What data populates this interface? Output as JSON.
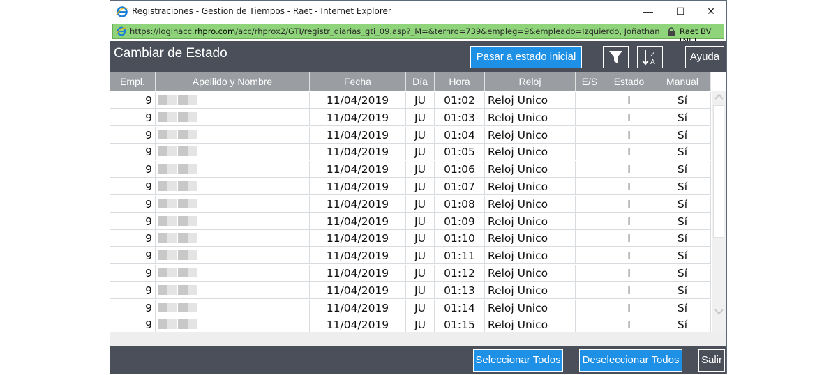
{
  "window": {
    "title": "Registraciones - Gestion de Tiempos - Raet - Internet Explorer",
    "minimize": "—",
    "maximize": "☐",
    "close": "✕"
  },
  "address": {
    "url_prefix": "https://loginacc.",
    "url_domain": "rhpro.com",
    "url_rest": "/acc/rhprox2/GTI/registr_diarias_gti_09.asp?_M=&ternro=739&empleg=9&empleado=Izquierdo, Joñathan&fechadesde",
    "certificate": "Raet BV [NL]"
  },
  "header": {
    "title": "Cambiar de Estado",
    "reset_label": "Pasar a estado inicial",
    "help_label": "Ayuda"
  },
  "table": {
    "columns": [
      "Empl.",
      "Apellido y Nombre",
      "Fecha",
      "Día",
      "Hora",
      "Reloj",
      "E/S",
      "Estado",
      "Manual"
    ],
    "rows": [
      {
        "empl": "9",
        "fecha": "11/04/2019",
        "dia": "JU",
        "hora": "01:02",
        "reloj": "Reloj Unico",
        "es": "",
        "estado": "I",
        "manual": "Sí"
      },
      {
        "empl": "9",
        "fecha": "11/04/2019",
        "dia": "JU",
        "hora": "01:03",
        "reloj": "Reloj Unico",
        "es": "",
        "estado": "I",
        "manual": "Sí"
      },
      {
        "empl": "9",
        "fecha": "11/04/2019",
        "dia": "JU",
        "hora": "01:04",
        "reloj": "Reloj Unico",
        "es": "",
        "estado": "I",
        "manual": "Sí"
      },
      {
        "empl": "9",
        "fecha": "11/04/2019",
        "dia": "JU",
        "hora": "01:05",
        "reloj": "Reloj Unico",
        "es": "",
        "estado": "I",
        "manual": "Sí"
      },
      {
        "empl": "9",
        "fecha": "11/04/2019",
        "dia": "JU",
        "hora": "01:06",
        "reloj": "Reloj Unico",
        "es": "",
        "estado": "I",
        "manual": "Sí"
      },
      {
        "empl": "9",
        "fecha": "11/04/2019",
        "dia": "JU",
        "hora": "01:07",
        "reloj": "Reloj Unico",
        "es": "",
        "estado": "I",
        "manual": "Sí"
      },
      {
        "empl": "9",
        "fecha": "11/04/2019",
        "dia": "JU",
        "hora": "01:08",
        "reloj": "Reloj Unico",
        "es": "",
        "estado": "I",
        "manual": "Sí"
      },
      {
        "empl": "9",
        "fecha": "11/04/2019",
        "dia": "JU",
        "hora": "01:09",
        "reloj": "Reloj Unico",
        "es": "",
        "estado": "I",
        "manual": "Sí"
      },
      {
        "empl": "9",
        "fecha": "11/04/2019",
        "dia": "JU",
        "hora": "01:10",
        "reloj": "Reloj Unico",
        "es": "",
        "estado": "I",
        "manual": "Sí"
      },
      {
        "empl": "9",
        "fecha": "11/04/2019",
        "dia": "JU",
        "hora": "01:11",
        "reloj": "Reloj Unico",
        "es": "",
        "estado": "I",
        "manual": "Sí"
      },
      {
        "empl": "9",
        "fecha": "11/04/2019",
        "dia": "JU",
        "hora": "01:12",
        "reloj": "Reloj Unico",
        "es": "",
        "estado": "I",
        "manual": "Sí"
      },
      {
        "empl": "9",
        "fecha": "11/04/2019",
        "dia": "JU",
        "hora": "01:13",
        "reloj": "Reloj Unico",
        "es": "",
        "estado": "I",
        "manual": "Sí"
      },
      {
        "empl": "9",
        "fecha": "11/04/2019",
        "dia": "JU",
        "hora": "01:14",
        "reloj": "Reloj Unico",
        "es": "",
        "estado": "I",
        "manual": "Sí"
      },
      {
        "empl": "9",
        "fecha": "11/04/2019",
        "dia": "JU",
        "hora": "01:15",
        "reloj": "Reloj Unico",
        "es": "",
        "estado": "I",
        "manual": "Sí"
      }
    ]
  },
  "footer": {
    "select_all_label": "Seleccionar Todos",
    "deselect_all_label": "Deseleccionar Todos",
    "exit_label": "Salir"
  },
  "icons": {
    "browser": "internet-explorer-icon",
    "lock": "lock-icon",
    "filter": "filter-icon",
    "sort": "sort-z-a-icon",
    "scroll_up": "chevron-up-icon",
    "scroll_down": "chevron-down-icon"
  },
  "colors": {
    "header_bg": "#4a4f5a",
    "accent_blue": "#1e90e6",
    "table_header_bg": "#9a9da2",
    "address_bar_green": "#8fd47a"
  }
}
